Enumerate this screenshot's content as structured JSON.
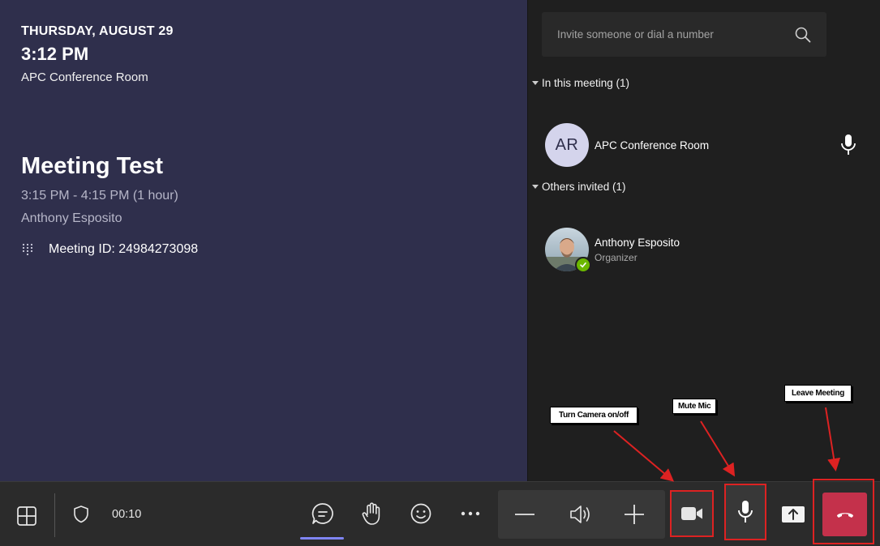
{
  "meeting_info": {
    "date": "THURSDAY, AUGUST 29",
    "time": "3:12 PM",
    "room": "APC Conference Room",
    "title": "Meeting Test",
    "time_range": "3:15 PM - 4:15 PM (1 hour)",
    "organizer": "Anthony Esposito",
    "meeting_id": "Meeting ID: 24984273098",
    "dialpad_icon": "dialpad-icon"
  },
  "participants_panel": {
    "invite_placeholder": "Invite someone or dial a number",
    "search_icon": "search-icon",
    "in_meeting_header": "In this meeting (1)",
    "others_invited_header": "Others invited (1)",
    "in_meeting": [
      {
        "initials": "AR",
        "name": "APC Conference Room",
        "mic_icon": "microphone-icon"
      }
    ],
    "invited": [
      {
        "name": "Anthony Esposito",
        "role": "Organizer",
        "presence": "available"
      }
    ]
  },
  "toolbar": {
    "timer": "00:10",
    "icons": [
      "grid-icon",
      "shield-icon",
      "chat-icon",
      "raise-hand-icon",
      "smile-icon",
      "more-icon",
      "minus-icon",
      "speaker-icon",
      "plus-icon",
      "camera-icon",
      "microphone-icon",
      "share-icon",
      "hang-up-icon"
    ]
  },
  "annotations": {
    "camera": "Turn Camera on/off",
    "mic": "Mute Mic",
    "leave": "Leave Meeting"
  },
  "colors": {
    "left_bg": "#2f2f4c",
    "panel_bg": "#1f1f1f",
    "toolbar_bg": "#2b2b2b",
    "accent": "#7f85f5",
    "leave_red": "#c4314b",
    "annotation_red": "#dd2222",
    "presence_green": "#6bb700"
  }
}
